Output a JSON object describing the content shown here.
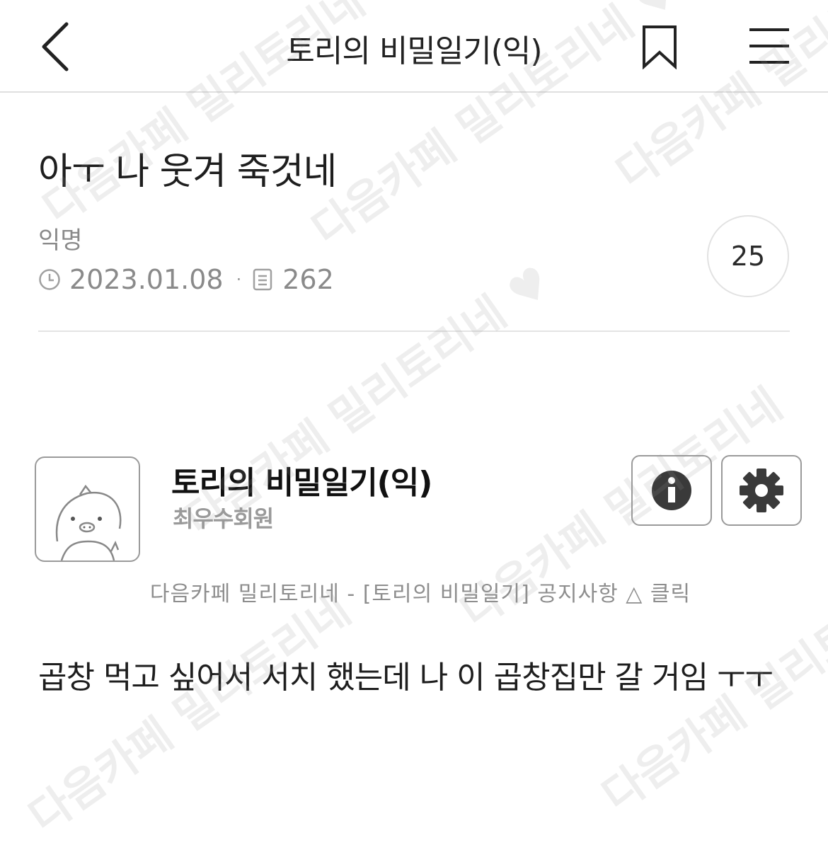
{
  "header": {
    "title": "토리의 비밀일기(익)"
  },
  "post": {
    "title": "아ㅜ 나 웃겨 죽것네",
    "author": "익명",
    "date": "2023.01.08",
    "views": "262",
    "comment_count": "25",
    "body": "곱창 먹고 싶어서 서치 했는데 나 이 곱창집만 갈 거임 ㅜㅜ"
  },
  "banner": {
    "board_name": "토리의 비밀일기(익)",
    "role": "최우수회원",
    "notice": "다음카페 밀리토리네 - [토리의 비밀일기] 공지사항 △ 클릭"
  },
  "watermark": {
    "text_a": "다음카페 밀리토리네 ♥",
    "text_b": "다음카페 밀리토리네"
  },
  "icons": {
    "back": "back-arrow-icon",
    "bookmark": "bookmark-icon",
    "menu": "hamburger-menu-icon",
    "clock": "clock-icon",
    "views": "document-icon",
    "info": "info-icon",
    "settings": "gear-icon",
    "avatar": "pig-mascot-icon"
  },
  "colors": {
    "text": "#1e1e1e",
    "meta": "#8a8a8a",
    "divider": "#e4e4e4",
    "banner_border": "#9a9a9a"
  }
}
